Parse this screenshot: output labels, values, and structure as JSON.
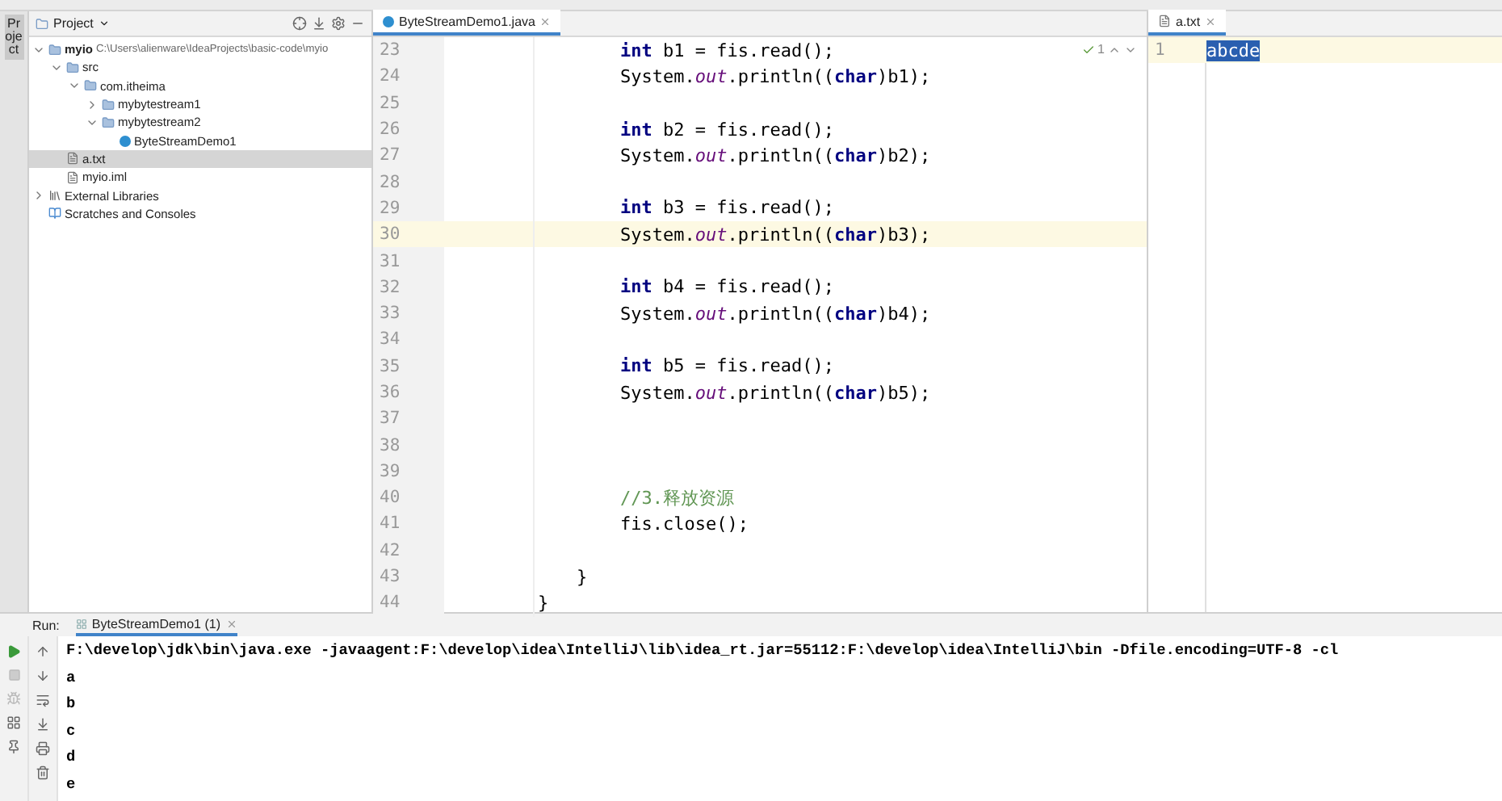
{
  "side_toolbar": {
    "label": "Project"
  },
  "project_panel": {
    "title": "Project",
    "tree": [
      {
        "name": "myio",
        "path": "C:\\Users\\alienware\\IdeaProjects\\basic-code\\myio",
        "kind": "module",
        "expanded": true,
        "selected": false,
        "children": [
          {
            "name": "src",
            "kind": "folder",
            "expanded": true,
            "selected": false,
            "children": [
              {
                "name": "com.itheima",
                "kind": "package",
                "expanded": true,
                "selected": false,
                "children": [
                  {
                    "name": "mybytestream1",
                    "kind": "package",
                    "expanded": false,
                    "selected": false
                  },
                  {
                    "name": "mybytestream2",
                    "kind": "package",
                    "expanded": true,
                    "selected": false,
                    "children": [
                      {
                        "name": "ByteStreamDemo1",
                        "kind": "class",
                        "selected": false
                      }
                    ]
                  }
                ]
              }
            ]
          },
          {
            "name": "a.txt",
            "kind": "text",
            "selected": true
          },
          {
            "name": "myio.iml",
            "kind": "iml",
            "selected": false
          }
        ]
      },
      {
        "name": "External Libraries",
        "kind": "library",
        "expanded": false,
        "selected": false
      },
      {
        "name": "Scratches and Consoles",
        "kind": "scratch",
        "selected": false
      }
    ]
  },
  "editor": {
    "tab": "ByteStreamDemo1.java",
    "inspection": "1",
    "lines": [
      {
        "number": "23",
        "current": false,
        "kind": "body",
        "tokens": [
          {
            "kind": "keyword",
            "text": "int"
          },
          {
            "kind": "plain",
            "text": " b1 = fis.read();"
          }
        ]
      },
      {
        "number": "24",
        "current": false,
        "kind": "body",
        "tokens": [
          {
            "kind": "plain",
            "text": "System."
          },
          {
            "kind": "field",
            "text": "out"
          },
          {
            "kind": "plain",
            "text": ".println(("
          },
          {
            "kind": "keyword",
            "text": "char"
          },
          {
            "kind": "plain",
            "text": ")b1);"
          }
        ]
      },
      {
        "number": "25",
        "current": false
      },
      {
        "number": "26",
        "current": false,
        "kind": "body",
        "tokens": [
          {
            "kind": "keyword",
            "text": "int"
          },
          {
            "kind": "plain",
            "text": " b2 = fis.read();"
          }
        ]
      },
      {
        "number": "27",
        "current": false,
        "kind": "body",
        "tokens": [
          {
            "kind": "plain",
            "text": "System."
          },
          {
            "kind": "field",
            "text": "out"
          },
          {
            "kind": "plain",
            "text": ".println(("
          },
          {
            "kind": "keyword",
            "text": "char"
          },
          {
            "kind": "plain",
            "text": ")b2);"
          }
        ]
      },
      {
        "number": "28",
        "current": false
      },
      {
        "number": "29",
        "current": false,
        "kind": "body",
        "tokens": [
          {
            "kind": "keyword",
            "text": "int"
          },
          {
            "kind": "plain",
            "text": " b3 = fis.read();"
          }
        ]
      },
      {
        "number": "30",
        "current": true,
        "kind": "body",
        "tokens": [
          {
            "kind": "plain",
            "text": "System."
          },
          {
            "kind": "field",
            "text": "out"
          },
          {
            "kind": "plain",
            "text": ".println(("
          },
          {
            "kind": "keyword",
            "text": "char"
          },
          {
            "kind": "plain",
            "text": ")b3);"
          }
        ]
      },
      {
        "number": "31",
        "current": false
      },
      {
        "number": "32",
        "current": false,
        "kind": "body",
        "tokens": [
          {
            "kind": "keyword",
            "text": "int"
          },
          {
            "kind": "plain",
            "text": " b4 = fis.read();"
          }
        ]
      },
      {
        "number": "33",
        "current": false,
        "kind": "body",
        "tokens": [
          {
            "kind": "plain",
            "text": "System."
          },
          {
            "kind": "field",
            "text": "out"
          },
          {
            "kind": "plain",
            "text": ".println(("
          },
          {
            "kind": "keyword",
            "text": "char"
          },
          {
            "kind": "plain",
            "text": ")b4);"
          }
        ]
      },
      {
        "number": "34",
        "current": false
      },
      {
        "number": "35",
        "current": false,
        "kind": "body",
        "tokens": [
          {
            "kind": "keyword",
            "text": "int"
          },
          {
            "kind": "plain",
            "text": " b5 = fis.read();"
          }
        ]
      },
      {
        "number": "36",
        "current": false,
        "kind": "body",
        "tokens": [
          {
            "kind": "plain",
            "text": "System."
          },
          {
            "kind": "field",
            "text": "out"
          },
          {
            "kind": "plain",
            "text": ".println(("
          },
          {
            "kind": "keyword",
            "text": "char"
          },
          {
            "kind": "plain",
            "text": ")b5);"
          }
        ]
      },
      {
        "number": "37",
        "current": false
      },
      {
        "number": "38",
        "current": false
      },
      {
        "number": "39",
        "current": false
      },
      {
        "number": "40",
        "current": false,
        "kind": "body",
        "tokens": [
          {
            "kind": "comment",
            "text": "//3.释放资源"
          }
        ]
      },
      {
        "number": "41",
        "current": false,
        "kind": "body",
        "tokens": [
          {
            "kind": "plain",
            "text": "fis.close();"
          }
        ]
      },
      {
        "number": "42",
        "current": false
      },
      {
        "number": "43",
        "current": false,
        "kind": "method_end",
        "tokens": [
          {
            "kind": "plain",
            "text": "}"
          }
        ]
      },
      {
        "number": "44",
        "current": false,
        "kind": "class_end",
        "tokens": [
          {
            "kind": "plain",
            "text": "}"
          }
        ]
      }
    ]
  },
  "text_editor": {
    "tab": "a.txt",
    "lines": [
      {
        "number": "1",
        "text": "abcde",
        "selected": true
      }
    ]
  },
  "run_panel": {
    "label": "Run:",
    "tab": "ByteStreamDemo1 (1)",
    "output": [
      "F:\\develop\\jdk\\bin\\java.exe -javaagent:F:\\develop\\idea\\IntelliJ\\lib\\idea_rt.jar=55112:F:\\develop\\idea\\IntelliJ\\bin -Dfile.encoding=UTF-8 -cl",
      "a",
      "b",
      "c",
      "d",
      "e"
    ]
  }
}
